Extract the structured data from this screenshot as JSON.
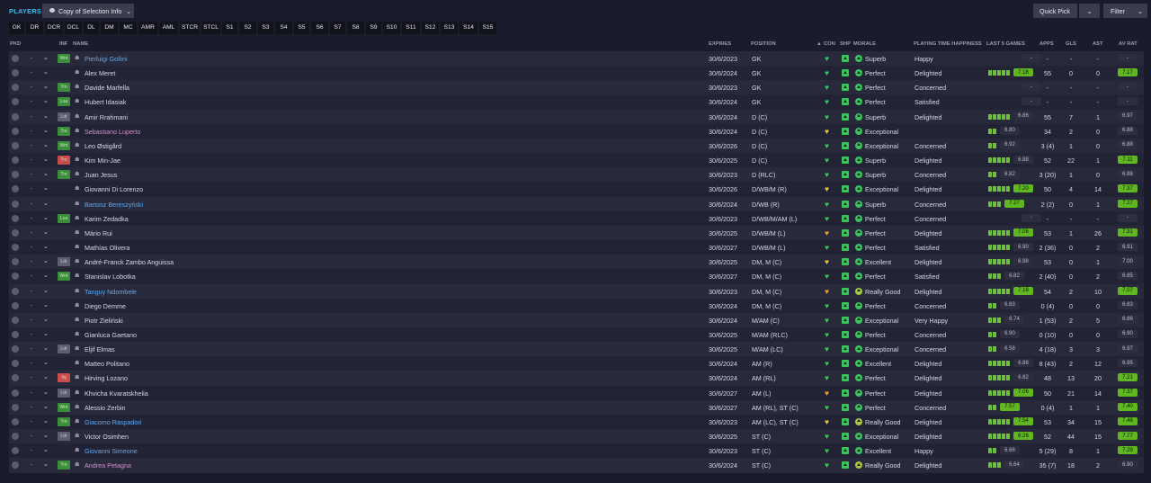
{
  "header": {
    "title": "PLAYERS",
    "view_label": "Copy of Selection Info",
    "quick_pick": "Quick Pick",
    "filter": "Filter",
    "chevron": "⌄"
  },
  "positions": [
    "GK",
    "DR",
    "DCR",
    "DCL",
    "DL",
    "DM",
    "MC",
    "AMR",
    "AML",
    "STCR",
    "STCL",
    "S1",
    "S2",
    "S3",
    "S4",
    "S5",
    "S6",
    "S7",
    "S8",
    "S9",
    "S10",
    "S11",
    "S12",
    "S13",
    "S14",
    "S15"
  ],
  "columns": {
    "pkd": "PKD",
    "inf": "INF",
    "name": "NAME",
    "expires": "EXPIRES",
    "position": "POSITION",
    "con": "CON",
    "shp": "SHP",
    "morale": "MORALE",
    "happiness": "PLAYING TIME HAPPINESS",
    "last5": "LAST 5 GAMES",
    "apps": "APPS",
    "gls": "GLS",
    "ast": "AST",
    "avrat": "AV RAT"
  },
  "colors": {
    "accent": "#38b8ef",
    "heart_green": "#37c65b",
    "heart_yellow": "#e8c443",
    "rating_lime": "#61b721",
    "morale_green": "#37c65b",
    "morale_yellow": "#a5c83a"
  },
  "players": [
    {
      "name": "Pierluigi Gollini",
      "name_color": "blue",
      "inf": "Wnt",
      "inf_color": "green",
      "expires": "30/6/2023",
      "position": "GK",
      "con": "green",
      "morale": "Superb",
      "happiness": "Happy",
      "bars": 0,
      "last5": "-",
      "last5_style": "plain",
      "apps": "-",
      "gls": "-",
      "ast": "-",
      "avrat": "-",
      "avrat_style": "dash2"
    },
    {
      "name": "Alex Meret",
      "name_color": "white",
      "inf": "",
      "inf_color": "",
      "expires": "30/6/2024",
      "position": "GK",
      "con": "green",
      "morale": "Perfect",
      "happiness": "Delighted",
      "bars": 5,
      "last5": "7.18",
      "last5_style": "lime",
      "apps": "55",
      "gls": "0",
      "ast": "0",
      "avrat": "7.17",
      "avrat_style": "lime"
    },
    {
      "name": "Davide Marfella",
      "name_color": "white",
      "inf": "Trn",
      "inf_color": "green",
      "expires": "30/6/2023",
      "position": "GK",
      "con": "green",
      "morale": "Perfect",
      "happiness": "Concerned",
      "bars": 0,
      "last5": "-",
      "last5_style": "plain",
      "apps": "-",
      "gls": "-",
      "ast": "-",
      "avrat": "-",
      "avrat_style": "dash2"
    },
    {
      "name": "Hubert Idasiak",
      "name_color": "white",
      "inf": "Loa",
      "inf_color": "green",
      "expires": "30/6/2024",
      "position": "GK",
      "con": "green",
      "morale": "Perfect",
      "happiness": "Satisfied",
      "bars": 0,
      "last5": "-",
      "last5_style": "plain",
      "apps": "-",
      "gls": "-",
      "ast": "-",
      "avrat": "-",
      "avrat_style": "dash2"
    },
    {
      "name": "Amir Rrahmani",
      "name_color": "white",
      "inf": "Ldr",
      "inf_color": "grey",
      "expires": "30/6/2024",
      "position": "D (C)",
      "con": "green",
      "morale": "Superb",
      "happiness": "Delighted",
      "bars": 5,
      "last5": "6.86",
      "last5_style": "plain",
      "apps": "55",
      "gls": "7",
      "ast": "1",
      "avrat": "6.97",
      "avrat_style": "plain"
    },
    {
      "name": "Sebastiano Luperto",
      "name_color": "pink",
      "inf": "Trn",
      "inf_color": "green",
      "expires": "30/6/2024",
      "position": "D (C)",
      "con": "yellow",
      "morale": "Exceptional",
      "happiness": "",
      "bars": 2,
      "last5": "6.80",
      "last5_style": "plain",
      "apps": "34",
      "gls": "2",
      "ast": "0",
      "avrat": "6.88",
      "avrat_style": "plain"
    },
    {
      "name": "Leo Østigård",
      "name_color": "white",
      "inf": "Wnt",
      "inf_color": "green",
      "expires": "30/6/2026",
      "position": "D (C)",
      "con": "green",
      "morale": "Exceptional",
      "happiness": "Concerned",
      "bars": 2,
      "last5": "6.92",
      "last5_style": "plain",
      "apps": "3 (4)",
      "gls": "1",
      "ast": "0",
      "avrat": "6.88",
      "avrat_style": "plain"
    },
    {
      "name": "Kim Min-Jae",
      "name_color": "white",
      "inf": "Trn",
      "inf_color": "red",
      "expires": "30/6/2025",
      "position": "D (C)",
      "con": "green",
      "morale": "Superb",
      "happiness": "Delighted",
      "bars": 5,
      "last5": "6.88",
      "last5_style": "plain",
      "apps": "52",
      "gls": "22",
      "ast": "1",
      "avrat": "7.11",
      "avrat_style": "lime"
    },
    {
      "name": "Juan Jesus",
      "name_color": "white",
      "inf": "Trn",
      "inf_color": "green",
      "expires": "30/6/2023",
      "position": "D (RLC)",
      "con": "green",
      "morale": "Superb",
      "happiness": "Concerned",
      "bars": 2,
      "last5": "6.82",
      "last5_style": "plain",
      "apps": "3 (20)",
      "gls": "1",
      "ast": "0",
      "avrat": "6.88",
      "avrat_style": "plain"
    },
    {
      "name": "Giovanni Di Lorenzo",
      "name_color": "white",
      "inf": "",
      "inf_color": "",
      "expires": "30/6/2026",
      "position": "D/WB/M (R)",
      "con": "yellow",
      "morale": "Exceptional",
      "happiness": "Delighted",
      "bars": 5,
      "last5": "7.20",
      "last5_style": "lime",
      "apps": "50",
      "gls": "4",
      "ast": "14",
      "avrat": "7.37",
      "avrat_style": "lime"
    },
    {
      "name": "Bartosz Bereszyński",
      "name_color": "blue",
      "inf": "",
      "inf_color": "",
      "expires": "30/6/2024",
      "position": "D/WB (R)",
      "con": "green",
      "morale": "Superb",
      "happiness": "Concerned",
      "bars": 3,
      "last5": "7.27",
      "last5_style": "lime",
      "apps": "2 (2)",
      "gls": "0",
      "ast": "1",
      "avrat": "7.27",
      "avrat_style": "lime"
    },
    {
      "name": "Karim Zedadka",
      "name_color": "white",
      "inf": "Loa",
      "inf_color": "green",
      "expires": "30/6/2023",
      "position": "D/WB/M/AM (L)",
      "con": "green",
      "morale": "Perfect",
      "happiness": "Concerned",
      "bars": 0,
      "last5": "-",
      "last5_style": "plain",
      "apps": "-",
      "gls": "-",
      "ast": "-",
      "avrat": "-",
      "avrat_style": "dash2"
    },
    {
      "name": "Mário Rui",
      "name_color": "white",
      "inf": "",
      "inf_color": "",
      "expires": "30/6/2025",
      "position": "D/WB/M (L)",
      "con": "orange",
      "morale": "Perfect",
      "happiness": "Delighted",
      "bars": 5,
      "last5": "7.06",
      "last5_style": "lime",
      "apps": "53",
      "gls": "1",
      "ast": "26",
      "avrat": "7.31",
      "avrat_style": "lime"
    },
    {
      "name": "Mathías Olivera",
      "name_color": "white",
      "inf": "",
      "inf_color": "",
      "expires": "30/6/2027",
      "position": "D/WB/M (L)",
      "con": "green",
      "morale": "Perfect",
      "happiness": "Satisfied",
      "bars": 5,
      "last5": "6.90",
      "last5_style": "plain",
      "apps": "2 (36)",
      "gls": "0",
      "ast": "2",
      "avrat": "6.91",
      "avrat_style": "plain"
    },
    {
      "name": "André-Franck Zambo Anguissa",
      "name_color": "white",
      "inf": "Ldr",
      "inf_color": "grey",
      "expires": "30/6/2025",
      "position": "DM, M (C)",
      "con": "yellow",
      "morale": "Excellent",
      "happiness": "Delighted",
      "bars": 5,
      "last5": "6.98",
      "last5_style": "plain",
      "apps": "53",
      "gls": "0",
      "ast": "1",
      "avrat": "7.00",
      "avrat_style": "plain"
    },
    {
      "name": "Stanislav Lobotka",
      "name_color": "white",
      "inf": "Wnt",
      "inf_color": "green",
      "expires": "30/6/2027",
      "position": "DM, M (C)",
      "con": "green",
      "morale": "Perfect",
      "happiness": "Satisfied",
      "bars": 3,
      "last5": "6.82",
      "last5_style": "plain",
      "apps": "2 (40)",
      "gls": "0",
      "ast": "2",
      "avrat": "6.85",
      "avrat_style": "plain"
    },
    {
      "name": "Tanguy Ndombele",
      "name_color": "blue",
      "inf": "",
      "inf_color": "",
      "expires": "30/6/2023",
      "position": "DM, M (C)",
      "con": "orange",
      "morale": "Really Good",
      "happiness": "Delighted",
      "bars": 5,
      "last5": "7.18",
      "last5_style": "lime",
      "apps": "54",
      "gls": "2",
      "ast": "10",
      "avrat": "7.07",
      "avrat_style": "lime"
    },
    {
      "name": "Diego Demme",
      "name_color": "white",
      "inf": "",
      "inf_color": "",
      "expires": "30/6/2024",
      "position": "DM, M (C)",
      "con": "green",
      "morale": "Perfect",
      "happiness": "Concerned",
      "bars": 2,
      "last5": "6.83",
      "last5_style": "plain",
      "apps": "0 (4)",
      "gls": "0",
      "ast": "0",
      "avrat": "6.83",
      "avrat_style": "plain"
    },
    {
      "name": "Piotr Zieliński",
      "name_color": "white",
      "inf": "",
      "inf_color": "",
      "expires": "30/6/2024",
      "position": "M/AM (C)",
      "con": "green",
      "morale": "Exceptional",
      "happiness": "Very Happy",
      "bars": 3,
      "last5": "6.74",
      "last5_style": "plain",
      "apps": "1 (53)",
      "gls": "2",
      "ast": "5",
      "avrat": "6.86",
      "avrat_style": "plain"
    },
    {
      "name": "Gianluca Gaetano",
      "name_color": "white",
      "inf": "",
      "inf_color": "",
      "expires": "30/6/2025",
      "position": "M/AM (RLC)",
      "con": "green",
      "morale": "Perfect",
      "happiness": "Concerned",
      "bars": 2,
      "last5": "6.90",
      "last5_style": "plain",
      "apps": "0 (10)",
      "gls": "0",
      "ast": "0",
      "avrat": "6.90",
      "avrat_style": "plain"
    },
    {
      "name": "Eljif Elmas",
      "name_color": "white",
      "inf": "Ldr",
      "inf_color": "grey",
      "expires": "30/6/2025",
      "position": "M/AM (LC)",
      "con": "green",
      "morale": "Exceptional",
      "happiness": "Concerned",
      "bars": 2,
      "last5": "6.58",
      "last5_style": "plain",
      "apps": "4 (18)",
      "gls": "3",
      "ast": "3",
      "avrat": "6.97",
      "avrat_style": "plain"
    },
    {
      "name": "Matteo Politano",
      "name_color": "white",
      "inf": "",
      "inf_color": "",
      "expires": "30/6/2024",
      "position": "AM (R)",
      "con": "green",
      "morale": "Excellent",
      "happiness": "Delighted",
      "bars": 5,
      "last5": "6.88",
      "last5_style": "plain",
      "apps": "8 (43)",
      "gls": "2",
      "ast": "12",
      "avrat": "6.95",
      "avrat_style": "plain"
    },
    {
      "name": "Hirving Lozano",
      "name_color": "white",
      "inf": "Inj",
      "inf_color": "red",
      "expires": "30/6/2024",
      "position": "AM (RL)",
      "con": "green",
      "morale": "Perfect",
      "happiness": "Delighted",
      "bars": 5,
      "last5": "6.82",
      "last5_style": "plain",
      "apps": "48",
      "gls": "13",
      "ast": "20",
      "avrat": "7.21",
      "avrat_style": "lime"
    },
    {
      "name": "Khvicha Kvaratskhelia",
      "name_color": "white",
      "inf": "Ldr",
      "inf_color": "grey",
      "expires": "30/6/2027",
      "position": "AM (L)",
      "con": "orange",
      "morale": "Perfect",
      "happiness": "Delighted",
      "bars": 5,
      "last5": "7.06",
      "last5_style": "lime",
      "apps": "50",
      "gls": "21",
      "ast": "14",
      "avrat": "7.37",
      "avrat_style": "lime"
    },
    {
      "name": "Alessio Zerbin",
      "name_color": "white",
      "inf": "Wnt",
      "inf_color": "green",
      "expires": "30/6/2027",
      "position": "AM (RL), ST (C)",
      "con": "green",
      "morale": "Perfect",
      "happiness": "Concerned",
      "bars": 2,
      "last5": "7.57",
      "last5_style": "lime",
      "apps": "0 (4)",
      "gls": "1",
      "ast": "1",
      "avrat": "7.40",
      "avrat_style": "lime"
    },
    {
      "name": "Giacomo Raspadori",
      "name_color": "blue",
      "inf": "Trn",
      "inf_color": "green",
      "expires": "30/6/2023",
      "position": "AM (LC), ST (C)",
      "con": "yellow",
      "morale": "Really Good",
      "happiness": "Delighted",
      "bars": 5,
      "last5": "7.54",
      "last5_style": "lime",
      "apps": "53",
      "gls": "34",
      "ast": "15",
      "avrat": "7.48",
      "avrat_style": "lime"
    },
    {
      "name": "Victor Osimhen",
      "name_color": "white",
      "inf": "Ldr",
      "inf_color": "grey",
      "expires": "30/6/2025",
      "position": "ST (C)",
      "con": "green",
      "morale": "Exceptional",
      "happiness": "Delighted",
      "bars": 5,
      "last5": "8.26",
      "last5_style": "lime",
      "apps": "52",
      "gls": "44",
      "ast": "15",
      "avrat": "7.77",
      "avrat_style": "lime"
    },
    {
      "name": "Giovanni Simeone",
      "name_color": "blue",
      "inf": "",
      "inf_color": "",
      "expires": "30/6/2023",
      "position": "ST (C)",
      "con": "green",
      "morale": "Excellent",
      "happiness": "Happy",
      "bars": 2,
      "last5": "6.66",
      "last5_style": "plain",
      "apps": "5 (29)",
      "gls": "8",
      "ast": "1",
      "avrat": "7.29",
      "avrat_style": "lime"
    },
    {
      "name": "Andrea Petagna",
      "name_color": "pink",
      "inf": "Trn",
      "inf_color": "green",
      "expires": "30/6/2024",
      "position": "ST (C)",
      "con": "green",
      "morale": "Really Good",
      "happiness": "Delighted",
      "bars": 3,
      "last5": "6.64",
      "last5_style": "plain",
      "apps": "35 (7)",
      "gls": "18",
      "ast": "2",
      "avrat": "6.90",
      "avrat_style": "plain"
    }
  ]
}
